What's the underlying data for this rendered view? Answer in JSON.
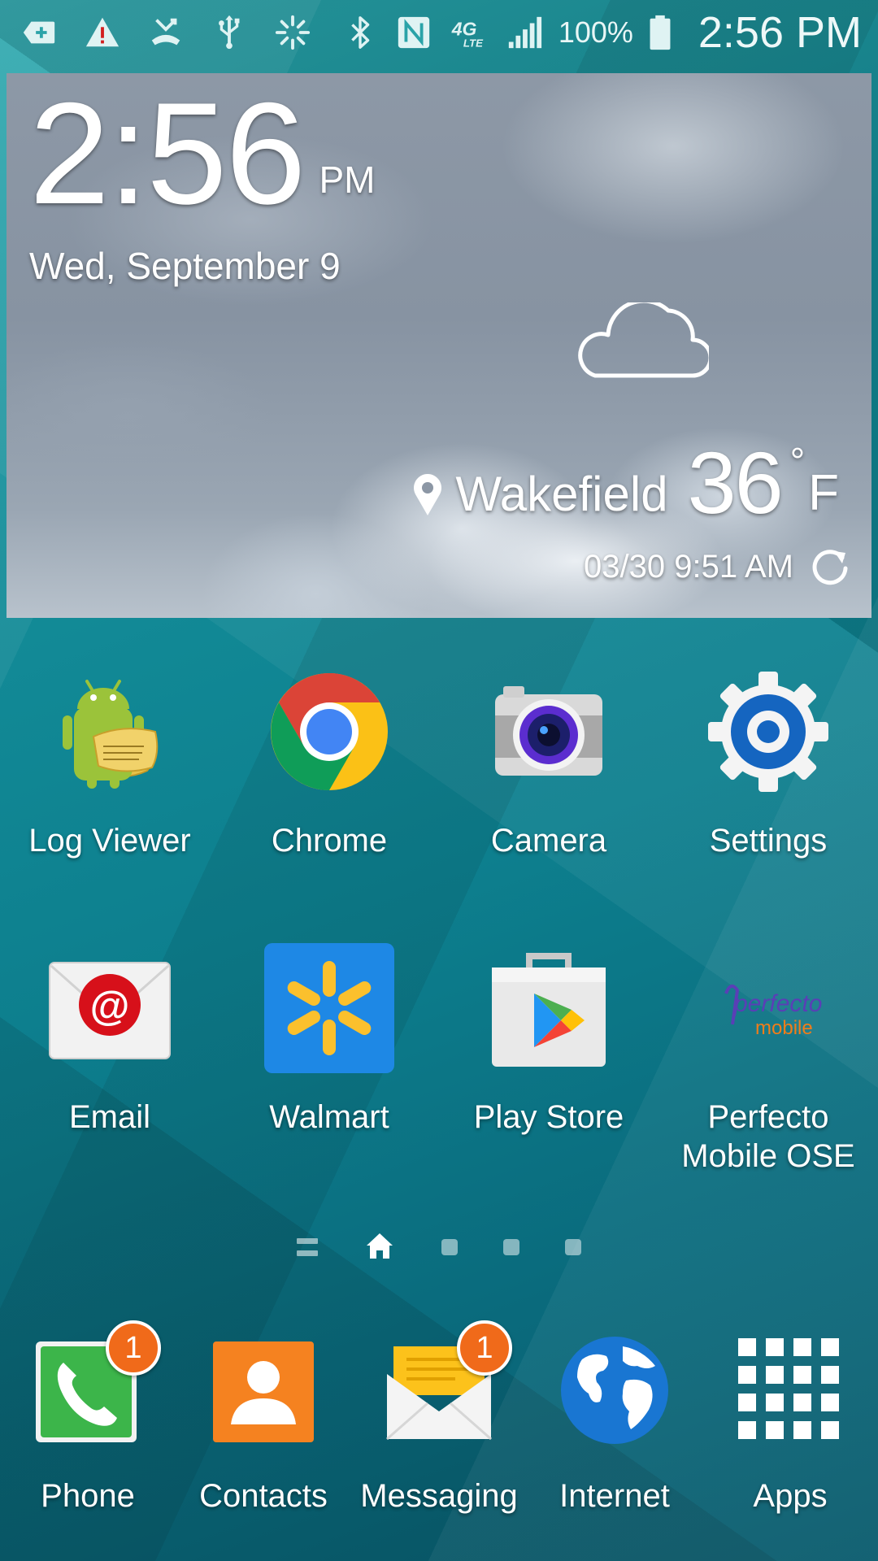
{
  "status_bar": {
    "left_icons": [
      "add-notification-icon",
      "warning-icon",
      "missed-call-icon",
      "usb-icon",
      "sync-icon"
    ],
    "right_icons": [
      "bluetooth-icon",
      "nfc-icon",
      "4g-lte-icon",
      "signal-icon"
    ],
    "network_label": "4G",
    "network_sub_label": "LTE",
    "battery_percent": "100%",
    "battery_level": 1.0,
    "time": "2:56 PM"
  },
  "clock_widget": {
    "time": "2:56",
    "ampm": "PM",
    "date": "Wed, September 9",
    "weather_icon": "cloud-icon",
    "location": "Wakefield",
    "temperature": "36",
    "degree_symbol": "°",
    "unit": "F",
    "updated": "03/30 9:51 AM",
    "refresh_icon": "refresh-icon"
  },
  "apps": [
    {
      "label": "Log Viewer",
      "icon": "log-viewer-icon"
    },
    {
      "label": "Chrome",
      "icon": "chrome-icon"
    },
    {
      "label": "Camera",
      "icon": "camera-icon"
    },
    {
      "label": "Settings",
      "icon": "settings-gear-icon"
    },
    {
      "label": "Email",
      "icon": "email-icon"
    },
    {
      "label": "Walmart",
      "icon": "walmart-icon"
    },
    {
      "label": "Play Store",
      "icon": "play-store-icon"
    },
    {
      "label": "Perfecto\nMobile OSE",
      "icon": "perfecto-mobile-icon",
      "logo_text_top": "perfecto",
      "logo_text_bottom": "mobile"
    }
  ],
  "page_indicator": {
    "pages": 5,
    "current": "home",
    "items": [
      "menu-icon",
      "home-icon",
      "dot",
      "dot",
      "dot"
    ]
  },
  "dock": [
    {
      "label": "Phone",
      "icon": "phone-icon",
      "badge": "1"
    },
    {
      "label": "Contacts",
      "icon": "contacts-icon"
    },
    {
      "label": "Messaging",
      "icon": "messaging-icon",
      "badge": "1"
    },
    {
      "label": "Internet",
      "icon": "globe-icon"
    },
    {
      "label": "Apps",
      "icon": "apps-grid-icon"
    }
  ],
  "colors": {
    "wallpaper": "#138c98",
    "badge": "#f06a1a",
    "walmart_blue": "#1e88e5",
    "walmart_yellow": "#fbc02d",
    "settings_blue": "#1565c0",
    "contacts_orange": "#f58220",
    "phone_green": "#3cb54a"
  }
}
